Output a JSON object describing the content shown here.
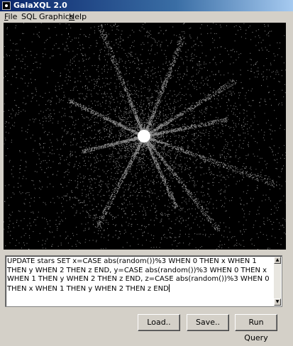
{
  "window": {
    "title": "GalaXQL 2.0"
  },
  "menu": [
    {
      "mnemonic": "F",
      "rest": "ile"
    },
    {
      "mnemonic": "",
      "rest": "SQL"
    },
    {
      "mnemonic": "",
      "rest": "Graphics"
    },
    {
      "mnemonic": "H",
      "rest": "elp"
    }
  ],
  "editor": {
    "query": "UPDATE stars SET x=CASE abs(random())%3 WHEN 0 THEN x WHEN 1 THEN y WHEN 2 THEN z END, y=CASE abs(random())%3 WHEN 0 THEN x WHEN 1 THEN y WHEN 2 THEN z END, z=CASE abs(random())%3 WHEN 0 THEN x WHEN 1 THEN y WHEN 2 THEN z END"
  },
  "buttons": {
    "load": "Load..",
    "save": "Save..",
    "run": "Run Query"
  },
  "colors": {
    "title_start": "#0a246a",
    "title_end": "#a6caf0",
    "canvas": "#000000",
    "face": "#d4d0c8"
  },
  "icons": {
    "app": "galaxy-icon",
    "scroll_up": "arrow-up-icon",
    "scroll_down": "arrow-down-icon"
  }
}
